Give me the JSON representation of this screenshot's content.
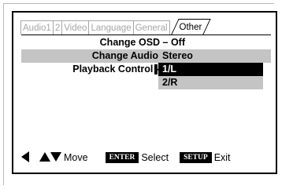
{
  "tabs": [
    "Audio1",
    "2",
    "Video",
    "Language",
    "General",
    "Other"
  ],
  "settings": [
    {
      "label": "Change OSD – Off"
    },
    {
      "label": "Change Audio"
    },
    {
      "label": "Playback Control -"
    }
  ],
  "options": [
    "Stereo",
    "1/L",
    "2/R"
  ],
  "selected_option": "1/L",
  "footer": {
    "move_label": "Move",
    "enter_key": "ENTER",
    "select_label": "Select",
    "setup_key": "SETUP",
    "exit_label": "Exit"
  }
}
